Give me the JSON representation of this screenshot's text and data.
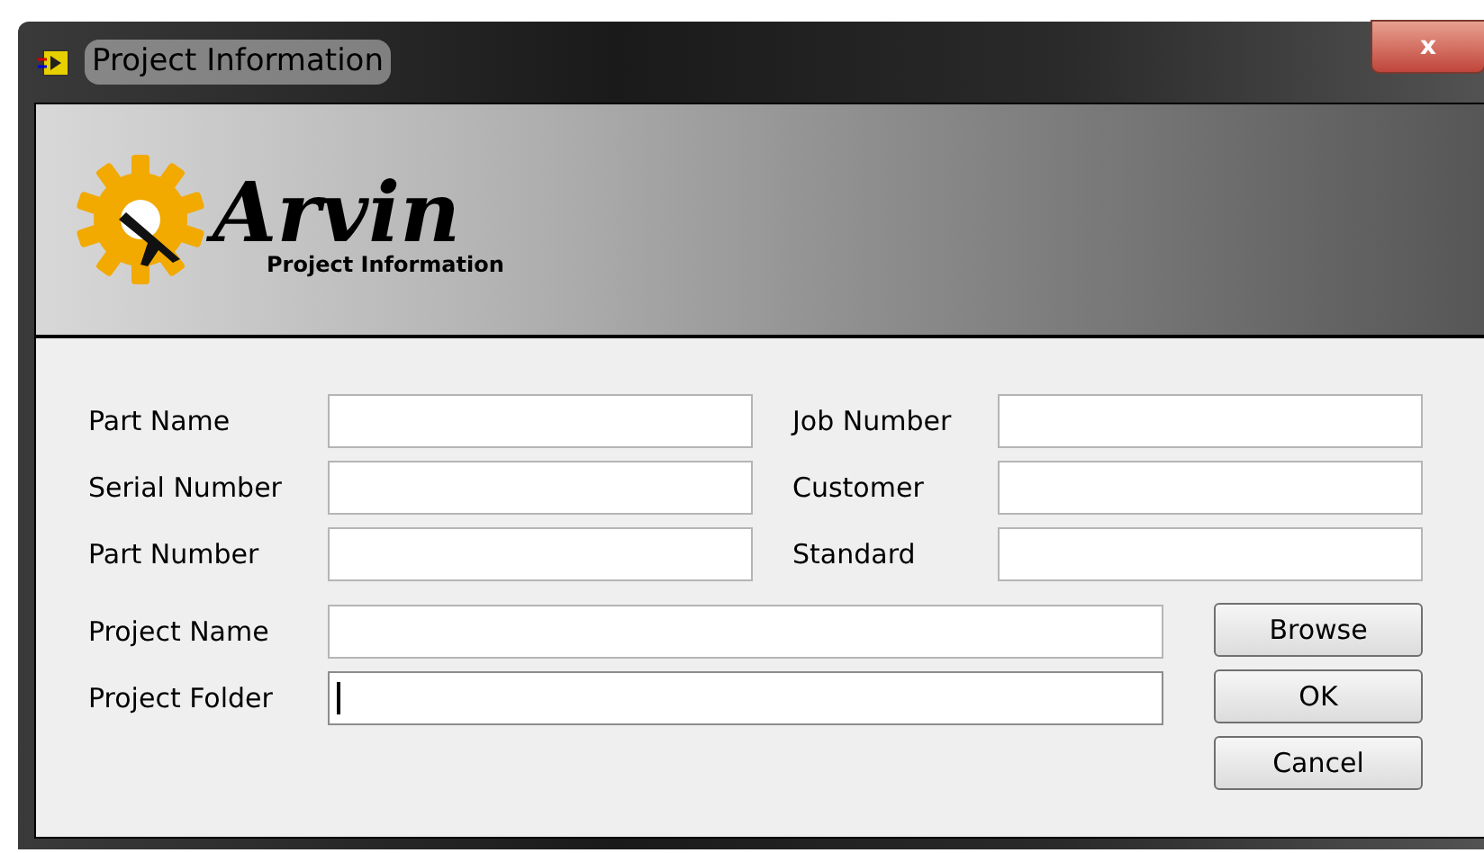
{
  "window": {
    "title": "Project Information",
    "close": "x"
  },
  "header": {
    "logo_text": "Arvin",
    "subtitle": "Project Information"
  },
  "left_fields": [
    {
      "label": "Part Name"
    },
    {
      "label": "Serial Number"
    },
    {
      "label": "Part Number"
    }
  ],
  "right_fields": [
    {
      "label": "Job Number"
    },
    {
      "label": "Customer"
    },
    {
      "label": "Standard"
    }
  ],
  "project_fields": [
    {
      "label": "Project Name",
      "focused": false
    },
    {
      "label": "Project Folder",
      "focused": true
    }
  ],
  "buttons": [
    "Browse",
    "OK",
    "Cancel"
  ]
}
